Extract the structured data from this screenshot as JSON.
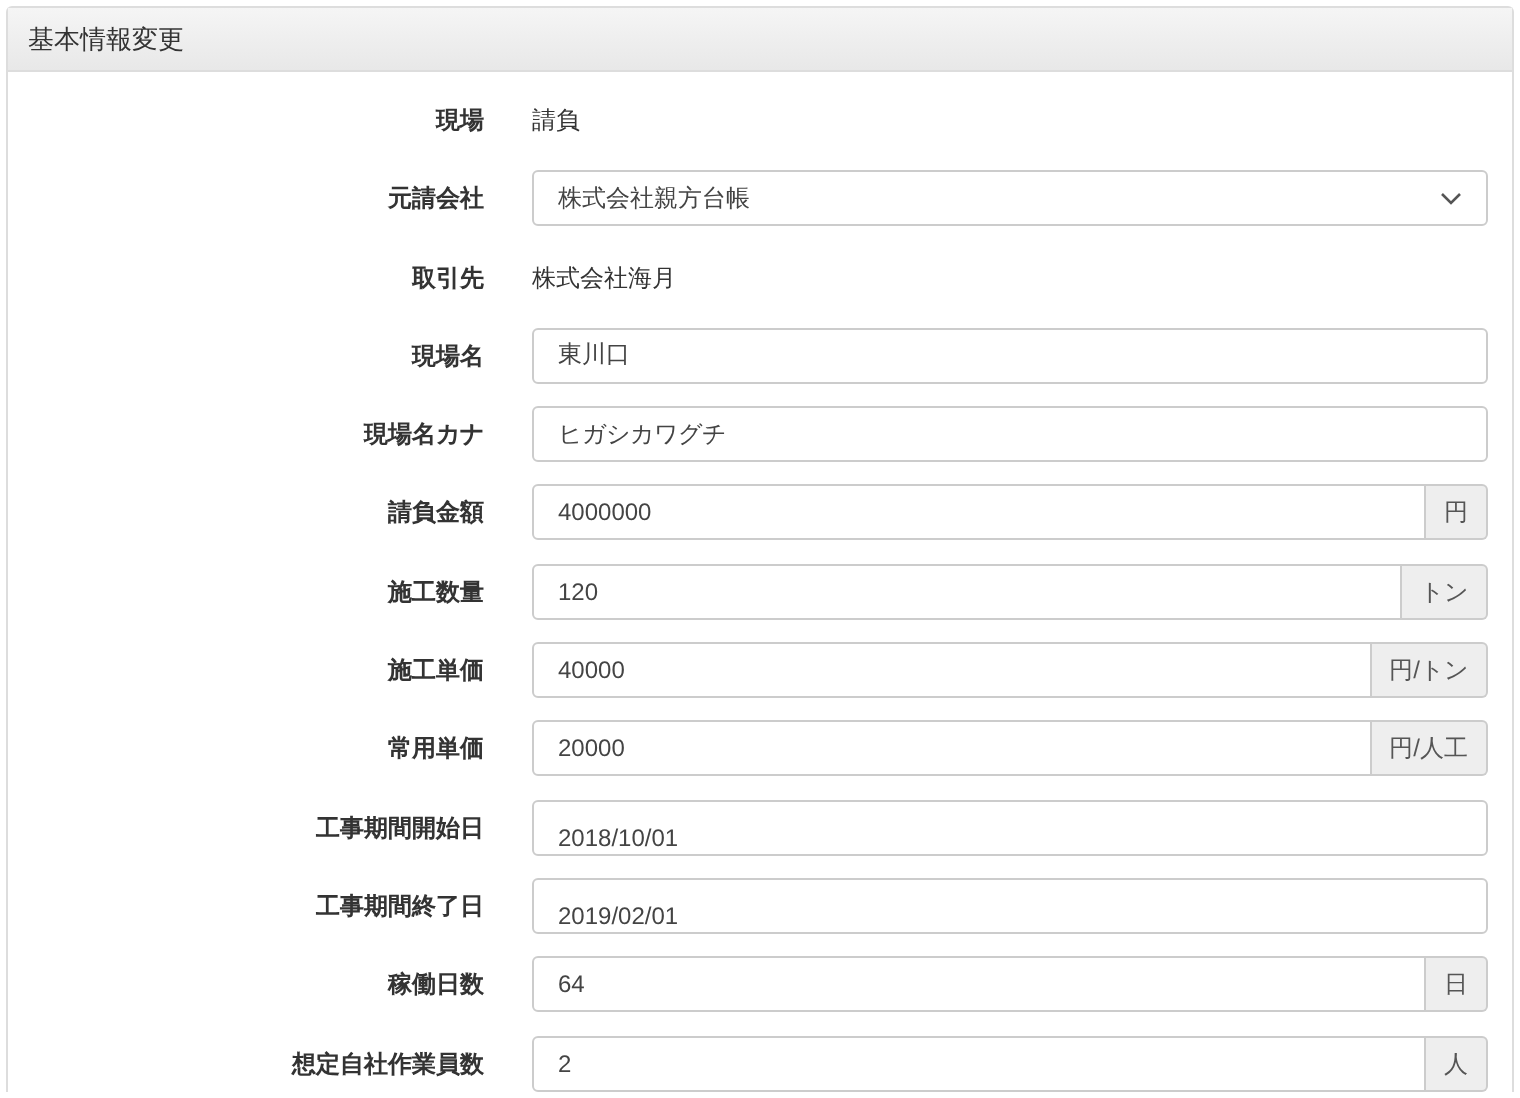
{
  "panel": {
    "title": "基本情報変更"
  },
  "fields": [
    {
      "kind": "text",
      "label": "現場",
      "value": "請負"
    },
    {
      "kind": "select",
      "label": "元請会社",
      "value": "株式会社親方台帳"
    },
    {
      "kind": "text",
      "label": "取引先",
      "value": "株式会社海月"
    },
    {
      "kind": "input",
      "label": "現場名",
      "value": "東川口"
    },
    {
      "kind": "input",
      "label": "現場名カナ",
      "value": "ヒガシカワグチ"
    },
    {
      "kind": "input",
      "label": "請負金額",
      "value": "4000000",
      "unit": "円"
    },
    {
      "kind": "input",
      "label": "施工数量",
      "value": "120",
      "unit": "トン"
    },
    {
      "kind": "input",
      "label": "施工単価",
      "value": "40000",
      "unit": "円/トン"
    },
    {
      "kind": "input",
      "label": "常用単価",
      "value": "20000",
      "unit": "円/人工"
    },
    {
      "kind": "date",
      "label": "工事期間開始日",
      "value": "2018/10/01"
    },
    {
      "kind": "date",
      "label": "工事期間終了日",
      "value": "2019/02/01"
    },
    {
      "kind": "input",
      "label": "稼働日数",
      "value": "64",
      "unit": "日"
    },
    {
      "kind": "input",
      "label": "想定自社作業員数",
      "value": "2",
      "unit": "人"
    }
  ]
}
